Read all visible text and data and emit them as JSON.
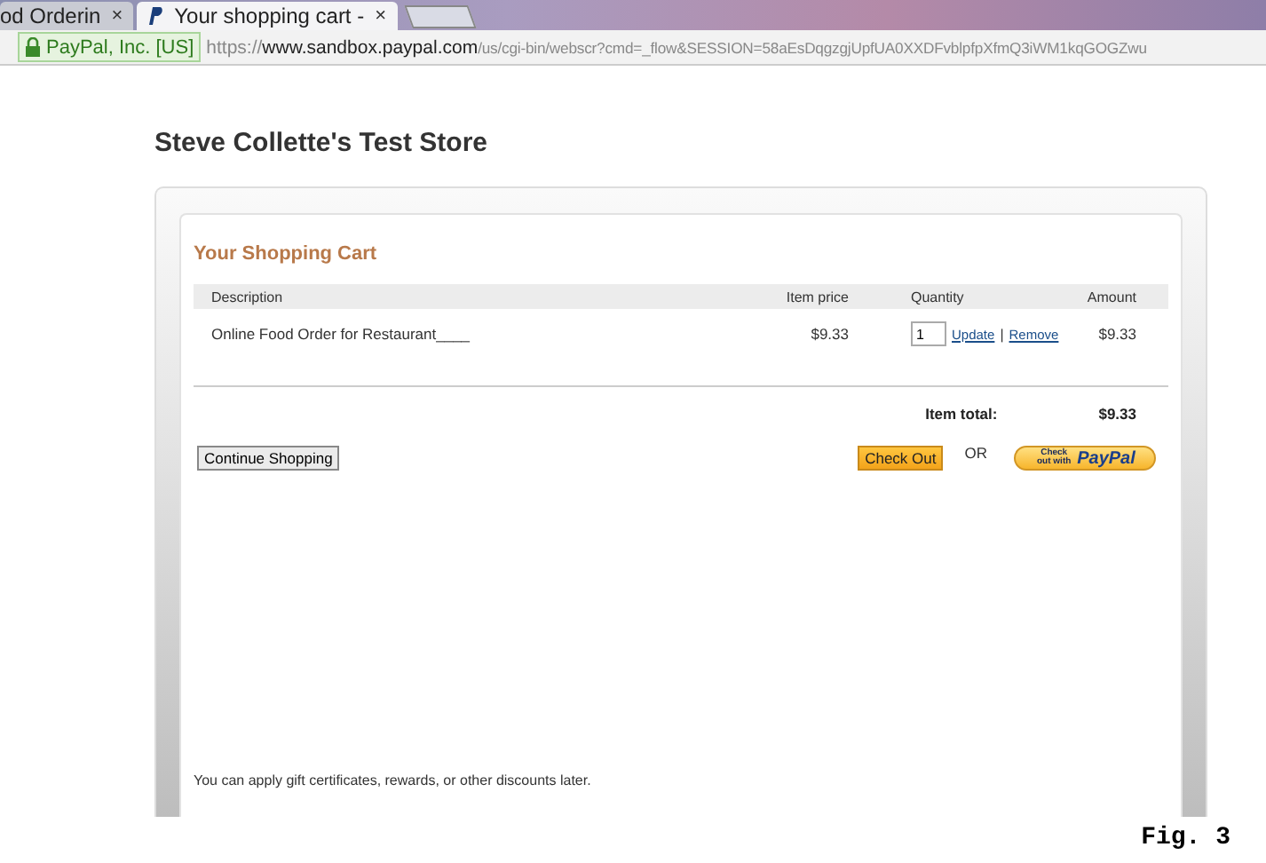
{
  "browser": {
    "tabs": [
      {
        "title": "od Orderin",
        "close": "×",
        "selected": false
      },
      {
        "title": "Your shopping cart -",
        "close": "×",
        "selected": true
      }
    ],
    "identity": "PayPal, Inc. [US]",
    "url_scheme": "https://",
    "url_host": "www.sandbox.paypal.com",
    "url_path": "/us/cgi-bin/webscr?cmd=_flow&SESSION=58aEsDqgzgjUpfUA0XXDFvblpfpXfmQ3iWM1kqGOGZwu"
  },
  "store_title": "Steve Collette's Test Store",
  "cart": {
    "heading": "Your Shopping Cart",
    "columns": [
      "Description",
      "Item price",
      "Quantity",
      "Amount"
    ],
    "rows": [
      {
        "description": "Online Food Order for Restaurant____",
        "price": "$9.33",
        "quantity": "1",
        "update": "Update",
        "separator": "|",
        "remove": "Remove",
        "amount": "$9.33"
      }
    ],
    "total_label": "Item total:",
    "total_value": "$9.33",
    "continue_button": "Continue Shopping",
    "checkout_button": "Check Out",
    "or": "OR",
    "paypal_button": {
      "small": "Check out with",
      "brand": "PayPal"
    },
    "note": "You can apply gift certificates, rewards, or other discounts later."
  },
  "caption": "Fig. 3"
}
